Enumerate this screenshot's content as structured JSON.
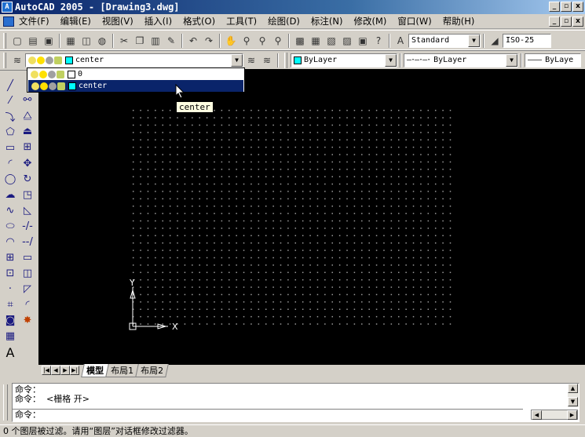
{
  "window": {
    "title": "AutoCAD 2005 - [Drawing3.dwg]",
    "minimize_glyph": "_",
    "restore_glyph": "▫",
    "close_glyph": "x"
  },
  "menu": {
    "items": [
      {
        "label": "文件(F)"
      },
      {
        "label": "编辑(E)"
      },
      {
        "label": "视图(V)"
      },
      {
        "label": "插入(I)"
      },
      {
        "label": "格式(O)"
      },
      {
        "label": "工具(T)"
      },
      {
        "label": "绘图(D)"
      },
      {
        "label": "标注(N)"
      },
      {
        "label": "修改(M)"
      },
      {
        "label": "窗口(W)"
      },
      {
        "label": "帮助(H)"
      }
    ]
  },
  "standard_toolbar": {
    "text_style": "Standard",
    "dim_style": "ISO-25"
  },
  "layers_toolbar": {
    "current_layer": "center",
    "color": "ByLayer",
    "linetype": "ByLayer",
    "lineweight": "ByLaye",
    "layer_color": "#00ffff"
  },
  "layer_dropdown": {
    "options": [
      {
        "name": "0",
        "color": "#ffffff"
      },
      {
        "name": "center",
        "color": "#00ffff"
      }
    ],
    "selected": "center"
  },
  "tooltip": "center",
  "ucs": {
    "x_label": "X",
    "y_label": "Y"
  },
  "layout_tabs": [
    {
      "label": "模型",
      "active": true
    },
    {
      "label": "布局1",
      "active": false
    },
    {
      "label": "布局2",
      "active": false
    }
  ],
  "command_window": {
    "lines": [
      "命令：",
      "命令：  <栅格 开>"
    ],
    "prompt": "命令："
  },
  "status": "0 个图层被过滤。请用“图层”对话框修改过滤器。"
}
